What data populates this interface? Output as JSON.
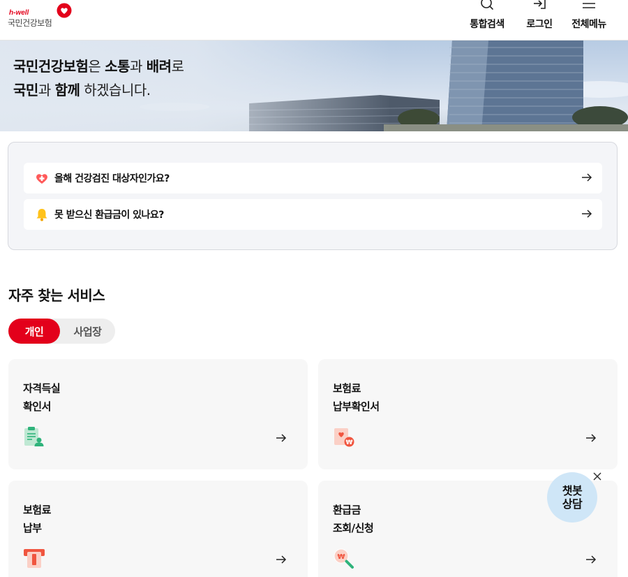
{
  "header": {
    "logo_sub": "h-well",
    "logo_name": "국민건강보험",
    "nav": [
      {
        "label": "통합검색",
        "icon": "search-icon"
      },
      {
        "label": "로그인",
        "icon": "login-icon"
      },
      {
        "label": "전체메뉴",
        "icon": "hamburger-menu-icon"
      }
    ]
  },
  "banner": {
    "line1": {
      "bold1": "국민건강보험",
      "text1": "은 ",
      "bold2": "소통",
      "text2": "과 ",
      "bold3": "배려",
      "text3": "로"
    },
    "line2": {
      "bold1": "국민",
      "text1": "과 ",
      "bold2": "함께",
      "text2": " 하겠습니다."
    }
  },
  "quick_links": [
    {
      "label": "올해 건강검진 대상자인가요?",
      "icon": "heart-checkup-icon"
    },
    {
      "label": "못 받으신 환급금이 있나요?",
      "icon": "bell-icon"
    }
  ],
  "services": {
    "title": "자주 찾는 서비스",
    "tabs": [
      {
        "label": "개인",
        "active": true
      },
      {
        "label": "사업장",
        "active": false
      }
    ],
    "cards": [
      {
        "line1": "자격득실",
        "line2": "확인서",
        "icon": "certificate-person-icon"
      },
      {
        "line1": "보험료",
        "line2": "납부확인서",
        "icon": "payment-certificate-icon"
      },
      {
        "line1": "보험료",
        "line2": "납부",
        "icon": "card-payment-icon"
      },
      {
        "line1": "환급금",
        "line2": "조회/신청",
        "icon": "refund-search-icon"
      }
    ]
  },
  "chatbot": {
    "line1": "챗봇",
    "line2": "상담"
  },
  "colors": {
    "brand_red": "#e3001b",
    "card_bg": "#f7f7f7",
    "chatbot_bg": "#cfe6f7"
  }
}
